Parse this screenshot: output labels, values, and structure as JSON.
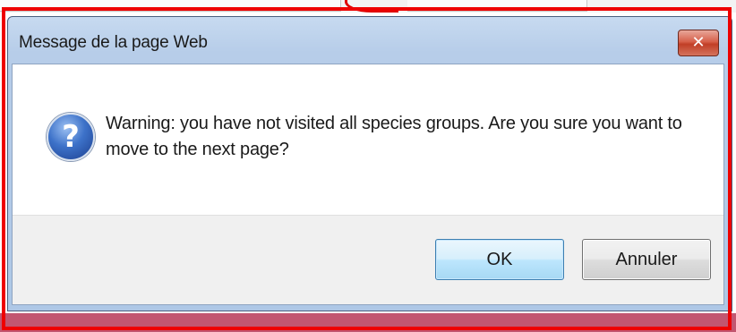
{
  "dialog": {
    "title": "Message de la page Web",
    "close_glyph": "✕",
    "icon": "question-icon",
    "message": "Warning: you have not visited all species groups. Are you sure you want to move to the next page?",
    "buttons": {
      "ok_label": "OK",
      "cancel_label": "Annuler"
    }
  },
  "colors": {
    "annotation_frame": "#ee0000",
    "titlebar": "#b7cde9",
    "close_button": "#c13e26",
    "page_background_bottom": "#c25670"
  }
}
